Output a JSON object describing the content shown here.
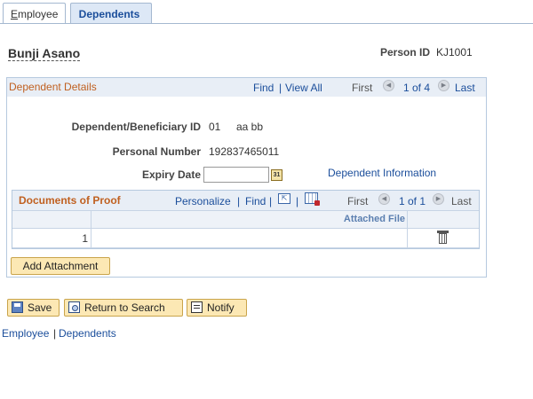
{
  "tabs": [
    {
      "prefix": "",
      "underlined": "E",
      "rest": "mployee"
    },
    {
      "label": "Dependents"
    }
  ],
  "person": {
    "name": "Bunji Asano",
    "id_label": "Person ID",
    "id_value": "KJ1001"
  },
  "dependent_details": {
    "title": "Dependent Details",
    "nav": {
      "find": "Find",
      "sep": "|",
      "view_all": "View All",
      "first": "First",
      "range": "1 of 4",
      "last": "Last"
    },
    "fields": {
      "dep_id_label": "Dependent/Beneficiary ID",
      "dep_id_value": "01",
      "dep_name": "aa bb",
      "personal_number_label": "Personal Number",
      "personal_number_value": "192837465011",
      "expiry_date_label": "Expiry Date",
      "expiry_date_value": ""
    },
    "dependent_information_link": "Dependent Information"
  },
  "documents_of_proof": {
    "title": "Documents of Proof",
    "toolbar": {
      "personalize": "Personalize",
      "sep": "|",
      "find": "Find",
      "first": "First",
      "range": "1 of 1",
      "last": "Last"
    },
    "columns": [
      "Attached File"
    ],
    "rows": [
      {
        "num": "1",
        "file": ""
      }
    ],
    "add_attachment": "Add Attachment"
  },
  "toolbar": {
    "save": "Save",
    "return_to_search": "Return to Search",
    "notify": "Notify"
  },
  "footer_links": {
    "employee": "Employee",
    "sep": "|",
    "dependents": "Dependents"
  }
}
